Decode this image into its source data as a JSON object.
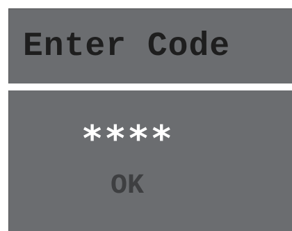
{
  "header": {
    "title": "Enter Code"
  },
  "keypad": {
    "masked_code": "****",
    "ok_label": "OK"
  },
  "colors": {
    "panel_background": "#6b6d70",
    "title_text": "#1e1e1e",
    "code_text": "#ffffff",
    "ok_text": "#3e3f41",
    "divider": "#ffffff"
  }
}
